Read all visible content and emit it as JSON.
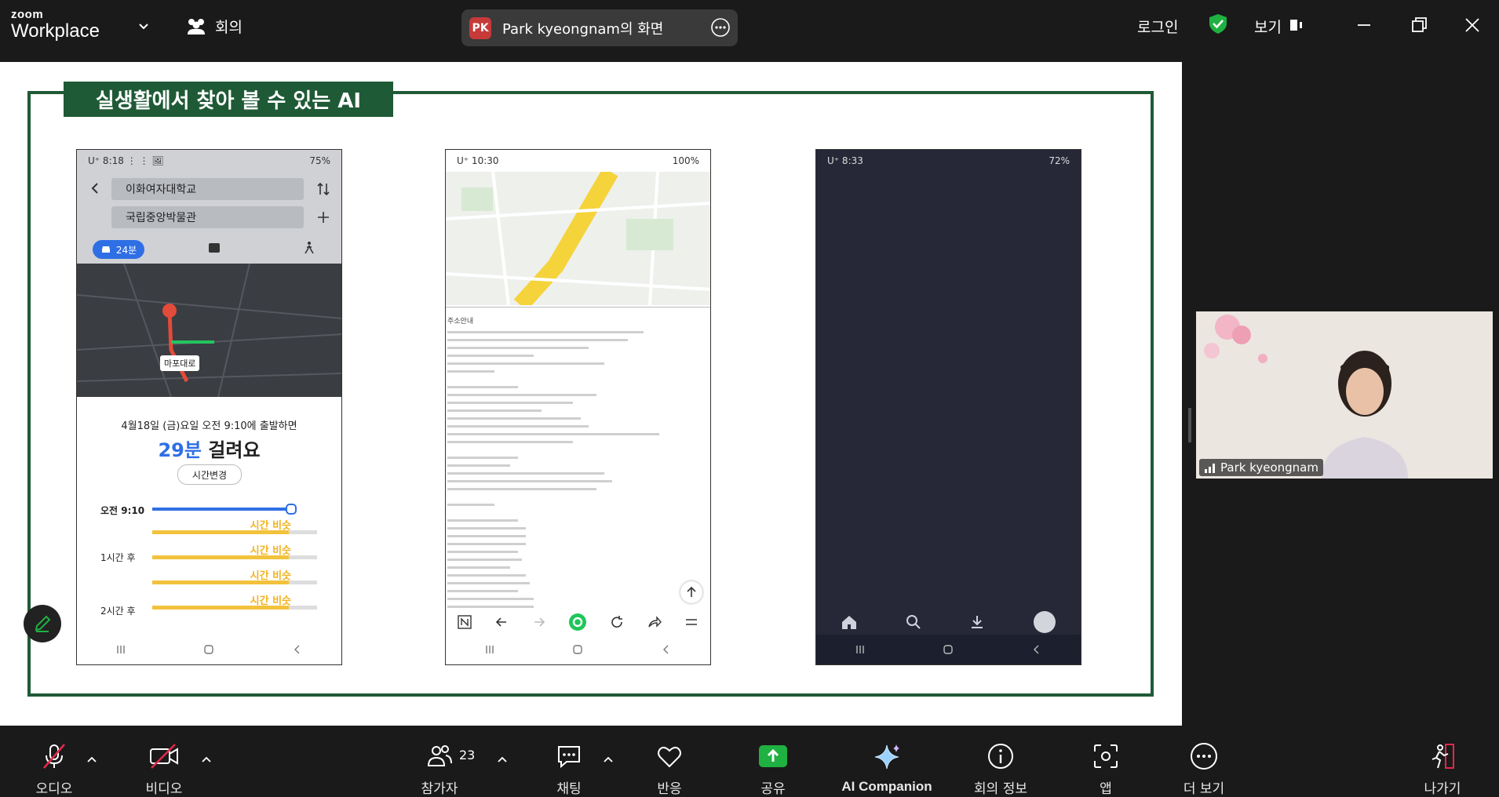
{
  "app": {
    "logo_line1": "zoom",
    "logo_line2": "Workplace",
    "meeting_label": "회의"
  },
  "share": {
    "initials": "PK",
    "title": "Park kyeongnam의 화면"
  },
  "topright": {
    "login": "로그인",
    "view": "보기"
  },
  "slide": {
    "title": "실생활에서 찾아 볼 수 있는 AI",
    "phone1": {
      "status_time": "U⁺ 8:18 ⋮ ⋮ 🖼",
      "status_right": "75%",
      "from": "이화여자대학교",
      "to": "국립중앙박물관",
      "mode_time": "24분",
      "depart": "4월18일 (금)요일 오전 9:10에 출발하면",
      "duration_num": "29분",
      "duration_text": "걸려요",
      "change_time": "시간변경",
      "label_0": "오전 9:10",
      "label_1": "1시간 후",
      "label_2": "2시간 후",
      "similar": "시간 비슷",
      "map_label": "마포대로"
    },
    "phone2": {
      "status_time": "U⁺ 10:30",
      "status_right": "100%",
      "doc_head": "주소안내"
    },
    "phone3": {
      "status_time": "U⁺ 8:33",
      "status_right": "72%"
    }
  },
  "participant": {
    "name": "Park kyeongnam"
  },
  "toolbar": {
    "audio": "오디오",
    "video": "비디오",
    "participants": "참가자",
    "participants_count": "23",
    "chat": "채팅",
    "react": "반응",
    "share": "공유",
    "ai": "AI Companion",
    "info": "회의 정보",
    "apps": "앱",
    "more": "더 보기",
    "leave": "나가기"
  },
  "colors": {
    "share_green": "#1fb141",
    "slide_green": "#1f5a36",
    "leave_red": "#e02a4a"
  }
}
